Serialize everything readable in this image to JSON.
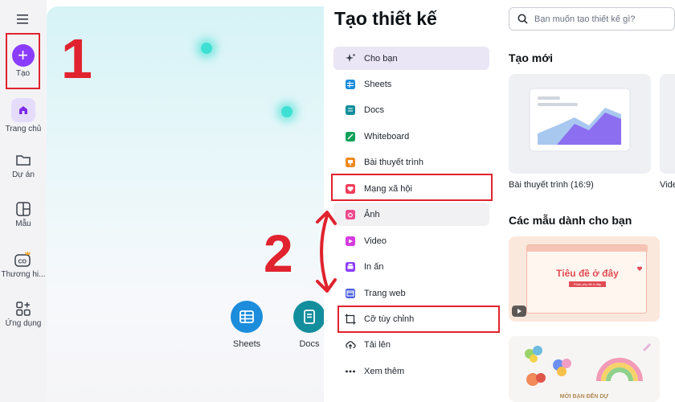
{
  "rail": {
    "create_label": "Tạo",
    "items": [
      {
        "label": "Trang chủ"
      },
      {
        "label": "Dự án"
      },
      {
        "label": "Mẫu"
      },
      {
        "label": "Thương hi..."
      },
      {
        "label": "Ứng dụng"
      }
    ]
  },
  "canvas": {
    "bubbles": [
      {
        "label": "Sheets",
        "color": "#1c8ddc"
      },
      {
        "label": "Docs",
        "color": "#138e9c"
      }
    ]
  },
  "panel": {
    "title": "Tạo thiết kế",
    "items": [
      {
        "label": "Cho bạn",
        "icon": "sparkle-icon"
      },
      {
        "label": "Sheets",
        "icon": "sheets-icon"
      },
      {
        "label": "Docs",
        "icon": "docs-icon"
      },
      {
        "label": "Whiteboard",
        "icon": "whiteboard-icon"
      },
      {
        "label": "Bài thuyết trình",
        "icon": "presentation-icon"
      },
      {
        "label": "Mạng xã hội",
        "icon": "heart-icon"
      },
      {
        "label": "Ảnh",
        "icon": "camera-icon"
      },
      {
        "label": "Video",
        "icon": "video-icon"
      },
      {
        "label": "In ấn",
        "icon": "printer-icon"
      },
      {
        "label": "Trang web",
        "icon": "web-icon"
      },
      {
        "label": "Cỡ tùy chỉnh",
        "icon": "resize-icon"
      },
      {
        "label": "Tải lên",
        "icon": "upload-icon"
      },
      {
        "label": "Xem thêm",
        "icon": "more-icon"
      }
    ]
  },
  "right": {
    "search_placeholder": "Bạn muốn tạo thiết kế gì?",
    "new_title": "Tạo mới",
    "new_items": [
      {
        "label": "Bài thuyết trình (16:9)"
      },
      {
        "label": "Vide"
      }
    ],
    "templates_title": "Các mẫu dành cho bạn",
    "template1_text": "Tiêu đề ở đây",
    "template1_sub": "Phần phụ đề ở đây",
    "template2_text": "MỜI BẠN ĐẾN DỰ"
  },
  "annotations": {
    "step1": "1",
    "step2": "2"
  },
  "colors": {
    "accent": "#8b3dff",
    "highlight": "#e0232e"
  }
}
